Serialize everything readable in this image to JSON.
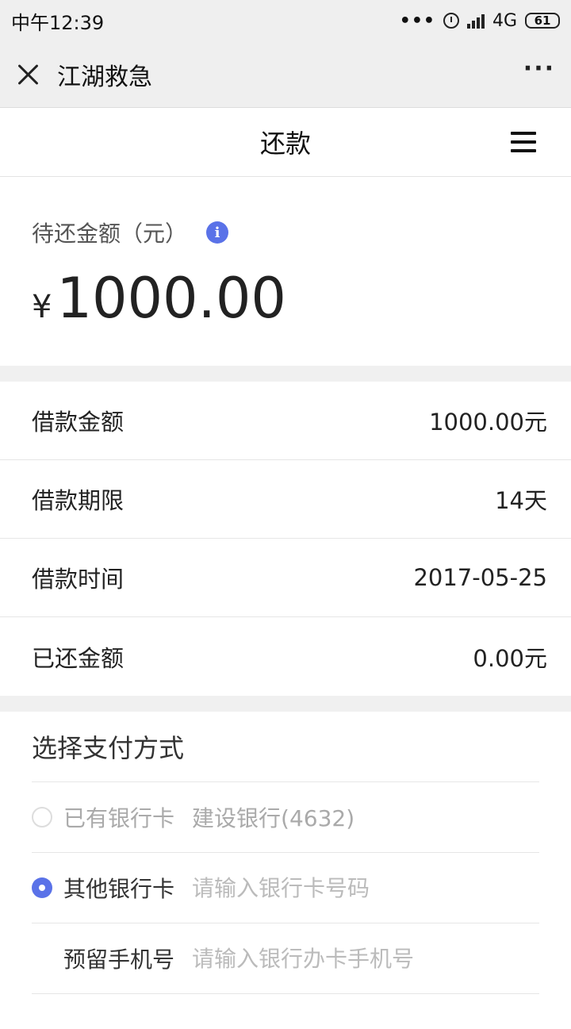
{
  "status_bar": {
    "time": "中午12:39",
    "network": "4G",
    "battery": "61"
  },
  "wx_nav": {
    "title": "江湖救急"
  },
  "page": {
    "title": "还款"
  },
  "amount_card": {
    "label": "待还金额（元）",
    "currency": "¥",
    "amount": "1000.00"
  },
  "loan_info": [
    {
      "label": "借款金额",
      "value": "1000.00元"
    },
    {
      "label": "借款期限",
      "value": "14天"
    },
    {
      "label": "借款时间",
      "value": "2017-05-25"
    },
    {
      "label": "已还金额",
      "value": "0.00元"
    }
  ],
  "payment": {
    "title": "选择支付方式",
    "existing_card": {
      "label": "已有银行卡",
      "value": "建设银行(4632)"
    },
    "other_card": {
      "label": "其他银行卡",
      "placeholder": "请输入银行卡号码"
    },
    "phone": {
      "label": "预留手机号",
      "placeholder": "请输入银行办卡手机号"
    }
  },
  "colors": {
    "accent": "#5a72e8"
  }
}
